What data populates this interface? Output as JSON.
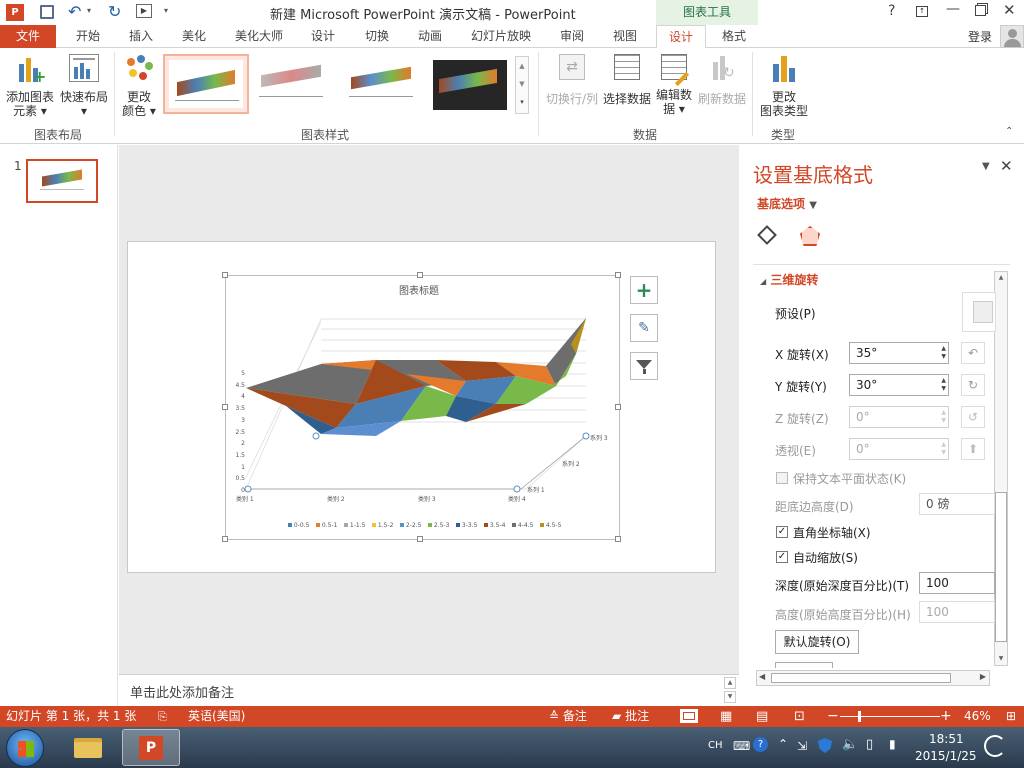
{
  "window": {
    "title": "新建 Microsoft PowerPoint 演示文稿 - PowerPoint",
    "context_tool": "图表工具",
    "help": "?",
    "login": "登录"
  },
  "tabs": [
    "文件",
    "开始",
    "插入",
    "美化",
    "美化大师",
    "设计",
    "切换",
    "动画",
    "幻灯片放映",
    "审阅",
    "视图",
    "设计",
    "格式"
  ],
  "active_tab_index": 11,
  "ribbon": {
    "add_element_line1": "添加图表",
    "add_element_line2": "元素 ▾",
    "quick_layout_line1": "快速布局",
    "quick_layout_line2": "▾",
    "group_layout": "图表布局",
    "change_color_line1": "更改",
    "change_color_line2": "颜色 ▾",
    "group_styles": "图表样式",
    "switch_rowcol": "切换行/列",
    "select_data": "选择数据",
    "edit_data_line1": "编辑数",
    "edit_data_line2": "据 ▾",
    "refresh_data": "刷新数据",
    "group_data": "数据",
    "change_type_line1": "更改",
    "change_type_line2": "图表类型",
    "group_type": "类型"
  },
  "thumbnail": {
    "number": "1"
  },
  "chart": {
    "title": "图表标题",
    "y_ticks": [
      "5",
      "4.5",
      "4",
      "3.5",
      "3",
      "2.5",
      "2",
      "1.5",
      "1",
      "0.5",
      "0"
    ],
    "categories": [
      "类别 1",
      "类别 2",
      "类别 3",
      "类别 4"
    ],
    "series_labels": [
      "系列 1",
      "系列 2",
      "系列 3"
    ],
    "legend": [
      "0-0.5",
      "0.5-1",
      "1-1.5",
      "1.5-2",
      "2-2.5",
      "2.5-3",
      "3-3.5",
      "3.5-4",
      "4-4.5",
      "4.5-5"
    ],
    "legend_colors": [
      "#4a7fb5",
      "#e37a2c",
      "#a6a6a6",
      "#f2c12e",
      "#5b8fd0",
      "#78b94a",
      "#2e5f8f",
      "#a34a1c",
      "#6d6d6d",
      "#b8901c"
    ]
  },
  "notes_placeholder": "单击此处添加备注",
  "pane": {
    "title": "设置基底格式",
    "options_label": "基底选项",
    "section": "三维旋转",
    "preset": "预设(P)",
    "x_label": "X 旋转(X)",
    "x_value": "35°",
    "y_label": "Y 旋转(Y)",
    "y_value": "30°",
    "z_label": "Z 旋转(Z)",
    "z_value": "0°",
    "persp_label": "透视(E)",
    "persp_value": "0°",
    "keep_text": "保持文本平面状态(K)",
    "distance_label": "距底边高度(D)",
    "distance_value": "0 磅",
    "right_angle": "直角坐标轴(X)",
    "autoscale": "自动缩放(S)",
    "depth_label": "深度(原始深度百分比)(T)",
    "depth_value": "100",
    "height_label": "高度(原始高度百分比)(H)",
    "height_value": "100",
    "default_rotation": "默认旋转(O)"
  },
  "status": {
    "slide_info": "幻灯片 第 1 张，共 1 张",
    "language": "英语(美国)",
    "notes": "备注",
    "comments": "批注",
    "zoom": "46%"
  },
  "taskbar": {
    "lang": "CH",
    "time": "18:51",
    "date": "2015/1/25"
  }
}
